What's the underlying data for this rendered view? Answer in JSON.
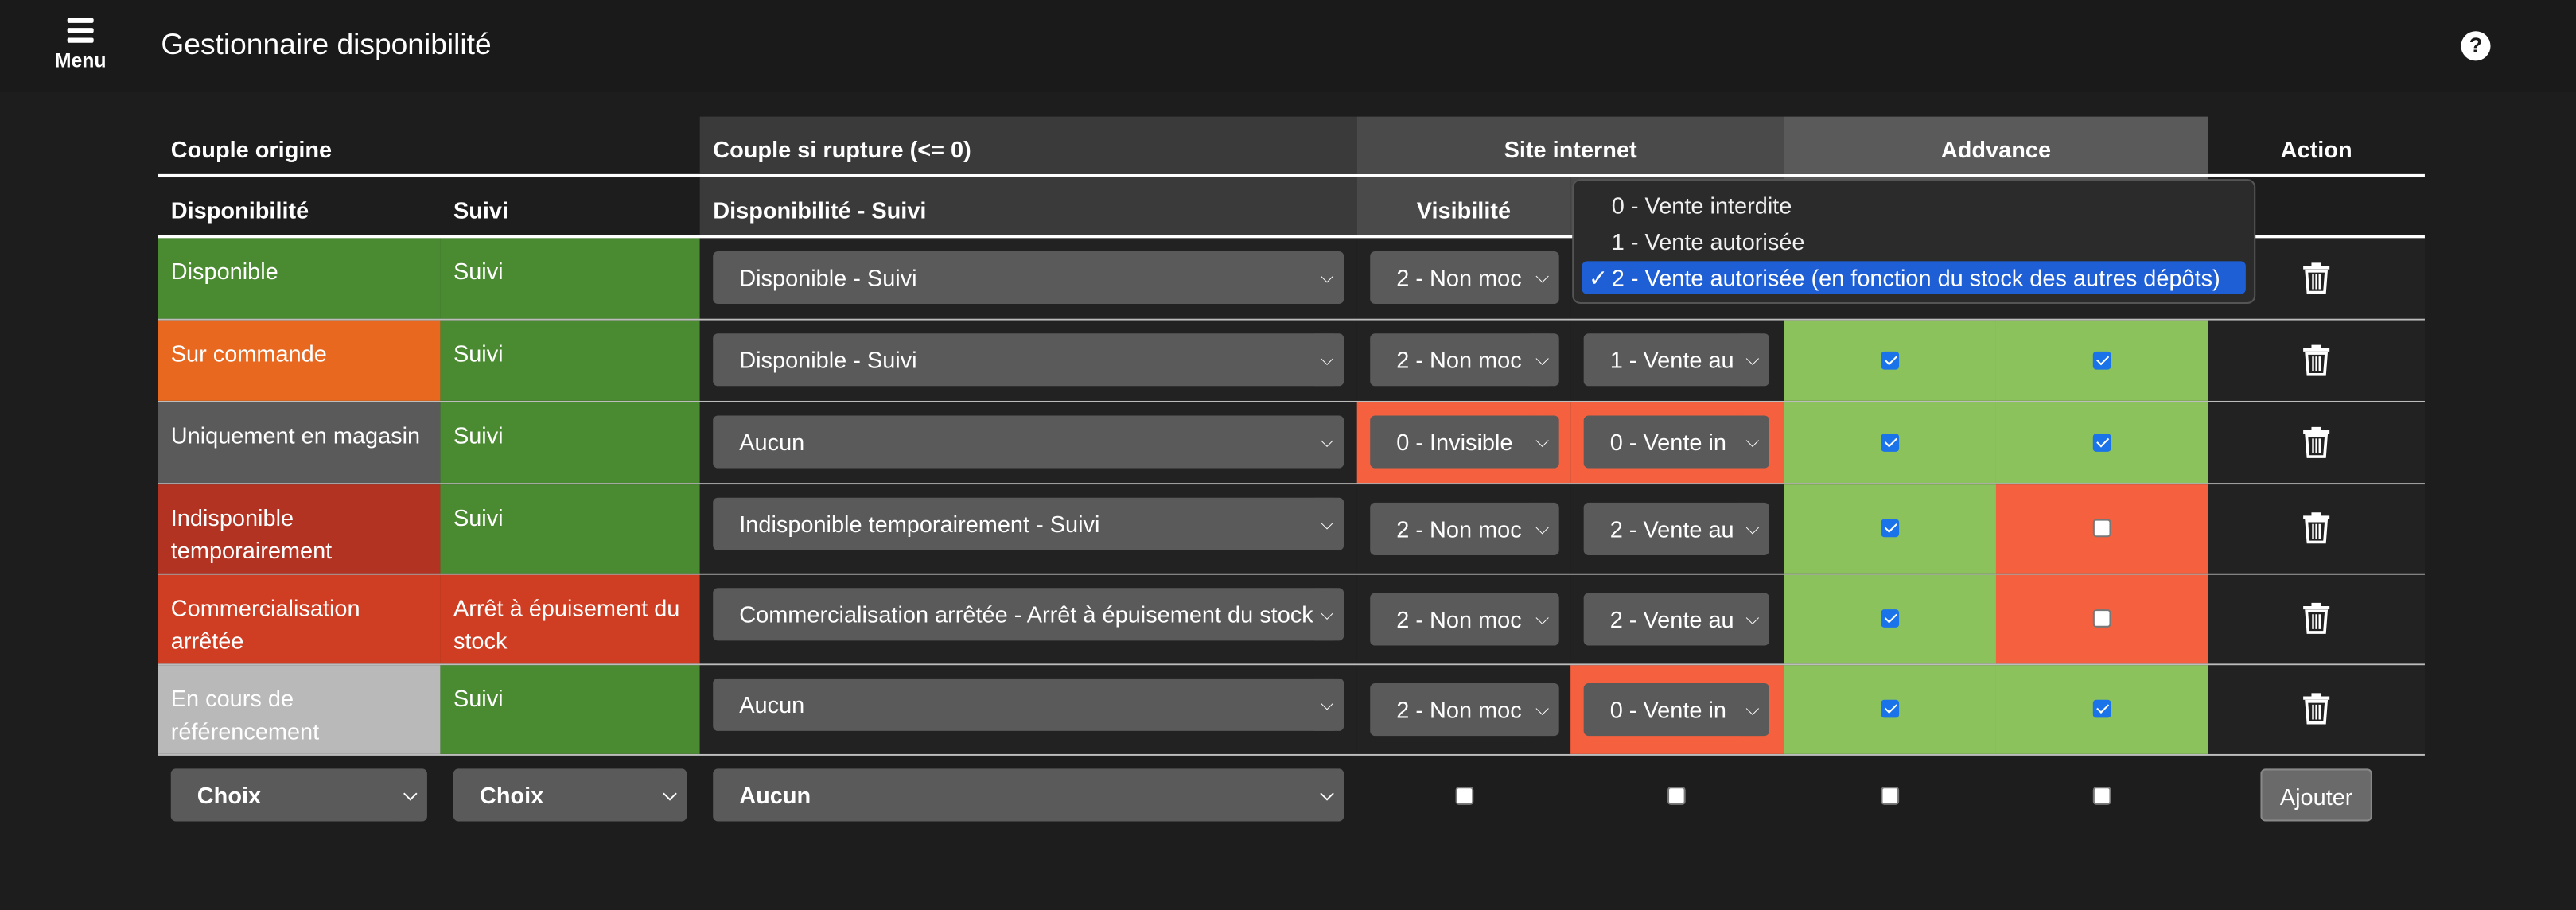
{
  "header": {
    "menu_label": "Menu",
    "title": "Gestionnaire disponibilité",
    "help_icon": "question-circle-icon"
  },
  "columns": {
    "group_origin": "Couple origine",
    "group_rupture": "Couple si rupture (<= 0)",
    "group_site": "Site internet",
    "group_addvance": "Addvance",
    "action": "Action",
    "disponibilite": "Disponibilité",
    "suivi": "Suivi",
    "dispo_suivi": "Disponibilité - Suivi",
    "visibilite": "Visibilité"
  },
  "rows": [
    {
      "dispo": "Disponible",
      "suivi": "Suivi",
      "rupture": "Disponible - Suivi",
      "visibilite": "2 - Non moc",
      "vente": "2 - Vente autorisée (en fonction du stock des autres dépôts)",
      "adv1": true,
      "adv2": true
    },
    {
      "dispo": "Sur commande",
      "suivi": "Suivi",
      "rupture": "Disponible - Suivi",
      "visibilite": "2 - Non moc",
      "vente": "1 - Vente au",
      "adv1": true,
      "adv2": true
    },
    {
      "dispo": "Uniquement en magasin",
      "suivi": "Suivi",
      "rupture": "Aucun",
      "visibilite": "0 - Invisible",
      "vente": "0 - Vente in",
      "adv1": true,
      "adv2": true
    },
    {
      "dispo": "Indisponible temporairement",
      "suivi": "Suivi",
      "rupture": "Indisponible temporairement - Suivi",
      "visibilite": "2 - Non moc",
      "vente": "2 - Vente au",
      "adv1": true,
      "adv2": false
    },
    {
      "dispo": "Commercialisation arrêtée",
      "suivi": "Arrêt à épuisement du stock",
      "rupture": "Commercialisation arrêtée - Arrêt à épuisement du stock",
      "visibilite": "2 - Non moc",
      "vente": "2 - Vente au",
      "adv1": true,
      "adv2": false
    },
    {
      "dispo": "En cours de référencement",
      "suivi": "Suivi",
      "rupture": "Aucun",
      "visibilite": "2 - Non moc",
      "vente": "0 - Vente in",
      "adv1": true,
      "adv2": true
    }
  ],
  "add_row": {
    "dispo_select": "Choix",
    "suivi_select": "Choix",
    "rupture_select": "Aucun",
    "add_button": "Ajouter"
  },
  "dropdown": {
    "options": [
      "0 - Vente interdite",
      "1 - Vente autorisée",
      "2 - Vente autorisée (en fonction du stock des autres dépôts)"
    ],
    "selected_index": 2,
    "check_glyph": "✓"
  },
  "colors": {
    "green": "#4a8a31",
    "orange": "#e8681f",
    "grey": "#5a5a5a",
    "red": "#b33322",
    "light_green": "#8cc25c",
    "salmon": "#f5613f",
    "silver": "#b9b9b9",
    "checkbox_blue": "#1a73e8"
  }
}
